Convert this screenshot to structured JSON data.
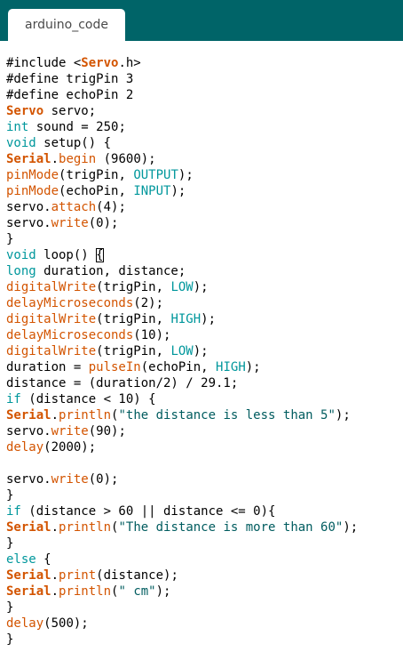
{
  "window": {
    "tab_label": "arduino_code"
  },
  "editor": {
    "lines": [
      [
        {
          "t": "#include <",
          "c": "d"
        },
        {
          "t": "Servo",
          "c": "c"
        },
        {
          "t": ".h>",
          "c": "d"
        }
      ],
      [
        {
          "t": "#define trigPin 3",
          "c": "d"
        }
      ],
      [
        {
          "t": "#define echoPin 2",
          "c": "d"
        }
      ],
      [
        {
          "t": "Servo",
          "c": "c"
        },
        {
          "t": " servo;",
          "c": "d"
        }
      ],
      [
        {
          "t": "int",
          "c": "k"
        },
        {
          "t": " sound = 250;",
          "c": "d"
        }
      ],
      [
        {
          "t": "void",
          "c": "k"
        },
        {
          "t": " setup() {",
          "c": "d"
        }
      ],
      [
        {
          "t": "Serial",
          "c": "c"
        },
        {
          "t": ".",
          "c": "d"
        },
        {
          "t": "begin",
          "c": "f"
        },
        {
          "t": " (9600);",
          "c": "d"
        }
      ],
      [
        {
          "t": "pinMode",
          "c": "f"
        },
        {
          "t": "(trigPin, ",
          "c": "d"
        },
        {
          "t": "OUTPUT",
          "c": "k"
        },
        {
          "t": ");",
          "c": "d"
        }
      ],
      [
        {
          "t": "pinMode",
          "c": "f"
        },
        {
          "t": "(echoPin, ",
          "c": "d"
        },
        {
          "t": "INPUT",
          "c": "k"
        },
        {
          "t": ");",
          "c": "d"
        }
      ],
      [
        {
          "t": "servo.",
          "c": "d"
        },
        {
          "t": "attach",
          "c": "f"
        },
        {
          "t": "(4);",
          "c": "d"
        }
      ],
      [
        {
          "t": "servo.",
          "c": "d"
        },
        {
          "t": "write",
          "c": "f"
        },
        {
          "t": "(0);",
          "c": "d"
        }
      ],
      [
        {
          "t": "}",
          "c": "d"
        }
      ],
      [
        {
          "t": "void",
          "c": "k"
        },
        {
          "t": " loop() ",
          "c": "d"
        },
        {
          "t": "{",
          "c": "d",
          "box": true
        }
      ],
      [
        {
          "t": "long",
          "c": "k"
        },
        {
          "t": " duration, distance;",
          "c": "d"
        }
      ],
      [
        {
          "t": "digitalWrite",
          "c": "f"
        },
        {
          "t": "(trigPin, ",
          "c": "d"
        },
        {
          "t": "LOW",
          "c": "k"
        },
        {
          "t": ");",
          "c": "d"
        }
      ],
      [
        {
          "t": "delayMicroseconds",
          "c": "f"
        },
        {
          "t": "(2);",
          "c": "d"
        }
      ],
      [
        {
          "t": "digitalWrite",
          "c": "f"
        },
        {
          "t": "(trigPin, ",
          "c": "d"
        },
        {
          "t": "HIGH",
          "c": "k"
        },
        {
          "t": ");",
          "c": "d"
        }
      ],
      [
        {
          "t": "delayMicroseconds",
          "c": "f"
        },
        {
          "t": "(10);",
          "c": "d"
        }
      ],
      [
        {
          "t": "digitalWrite",
          "c": "f"
        },
        {
          "t": "(trigPin, ",
          "c": "d"
        },
        {
          "t": "LOW",
          "c": "k"
        },
        {
          "t": ");",
          "c": "d"
        }
      ],
      [
        {
          "t": "duration = ",
          "c": "d"
        },
        {
          "t": "pulseIn",
          "c": "f"
        },
        {
          "t": "(echoPin, ",
          "c": "d"
        },
        {
          "t": "HIGH",
          "c": "k"
        },
        {
          "t": ");",
          "c": "d"
        }
      ],
      [
        {
          "t": "distance = (duration/2) / 29.1;",
          "c": "d"
        }
      ],
      [
        {
          "t": "if",
          "c": "k"
        },
        {
          "t": " (distance < 10) {",
          "c": "d"
        }
      ],
      [
        {
          "t": "Serial",
          "c": "c"
        },
        {
          "t": ".",
          "c": "d"
        },
        {
          "t": "println",
          "c": "f"
        },
        {
          "t": "(",
          "c": "d"
        },
        {
          "t": "\"the distance is less than 5\"",
          "c": "s"
        },
        {
          "t": ");",
          "c": "d"
        }
      ],
      [
        {
          "t": "servo.",
          "c": "d"
        },
        {
          "t": "write",
          "c": "f"
        },
        {
          "t": "(90);",
          "c": "d"
        }
      ],
      [
        {
          "t": "delay",
          "c": "f"
        },
        {
          "t": "(2000);",
          "c": "d"
        }
      ],
      [],
      [
        {
          "t": "servo.",
          "c": "d"
        },
        {
          "t": "write",
          "c": "f"
        },
        {
          "t": "(0);",
          "c": "d"
        }
      ],
      [
        {
          "t": "}",
          "c": "d"
        }
      ],
      [
        {
          "t": "if",
          "c": "k"
        },
        {
          "t": " (distance > 60 || distance <= 0){",
          "c": "d"
        }
      ],
      [
        {
          "t": "Serial",
          "c": "c"
        },
        {
          "t": ".",
          "c": "d"
        },
        {
          "t": "println",
          "c": "f"
        },
        {
          "t": "(",
          "c": "d"
        },
        {
          "t": "\"The distance is more than 60\"",
          "c": "s"
        },
        {
          "t": ");",
          "c": "d"
        }
      ],
      [
        {
          "t": "}",
          "c": "d"
        }
      ],
      [
        {
          "t": "else",
          "c": "k"
        },
        {
          "t": " {",
          "c": "d"
        }
      ],
      [
        {
          "t": "Serial",
          "c": "c"
        },
        {
          "t": ".",
          "c": "d"
        },
        {
          "t": "print",
          "c": "f"
        },
        {
          "t": "(distance);",
          "c": "d"
        }
      ],
      [
        {
          "t": "Serial",
          "c": "c"
        },
        {
          "t": ".",
          "c": "d"
        },
        {
          "t": "println",
          "c": "f"
        },
        {
          "t": "(",
          "c": "d"
        },
        {
          "t": "\" cm\"",
          "c": "s"
        },
        {
          "t": ");",
          "c": "d"
        }
      ],
      [
        {
          "t": "}",
          "c": "d"
        }
      ],
      [
        {
          "t": "delay",
          "c": "f"
        },
        {
          "t": "(500);",
          "c": "d"
        }
      ],
      [
        {
          "t": "}",
          "c": "d"
        }
      ]
    ]
  },
  "colors": {
    "tabbar_bg": "#006468",
    "keyword": "#00979c",
    "function": "#d35400",
    "string": "#005c5f"
  }
}
